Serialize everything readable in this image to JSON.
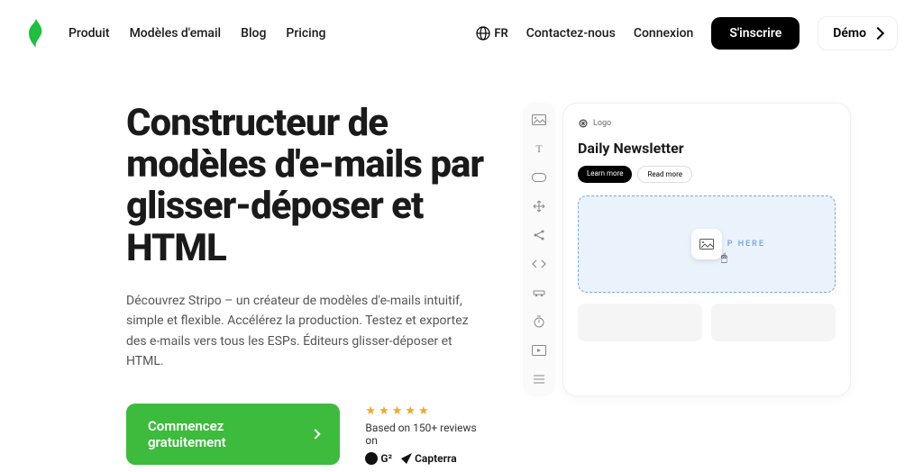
{
  "nav": {
    "items": [
      "Produit",
      "Modèles d'email",
      "Blog",
      "Pricing"
    ],
    "lang": "FR",
    "contact": "Contactez-nous",
    "login": "Connexion",
    "signup": "S'inscrire",
    "demo": "Démo"
  },
  "hero": {
    "title": "Constructeur de modèles d'e-mails par glisser-déposer et HTML",
    "desc": "Découvrez Stripo – un créateur de modèles d'e-mails intuitif, simple et flexible. Accélérez la production. Testez et exportez des e-mails vers tous les ESPs. Éditeurs glisser-déposer et HTML.",
    "cta": "Commencez gratuitement",
    "reviews_text": "Based on 150+ reviews on",
    "logo_g2": "G²",
    "logo_capterra": "Capterra"
  },
  "mockup": {
    "logo": "Logo",
    "title": "Daily Newsletter",
    "btn1": "Learn more",
    "btn2": "Read more",
    "drop": "P HERE"
  }
}
